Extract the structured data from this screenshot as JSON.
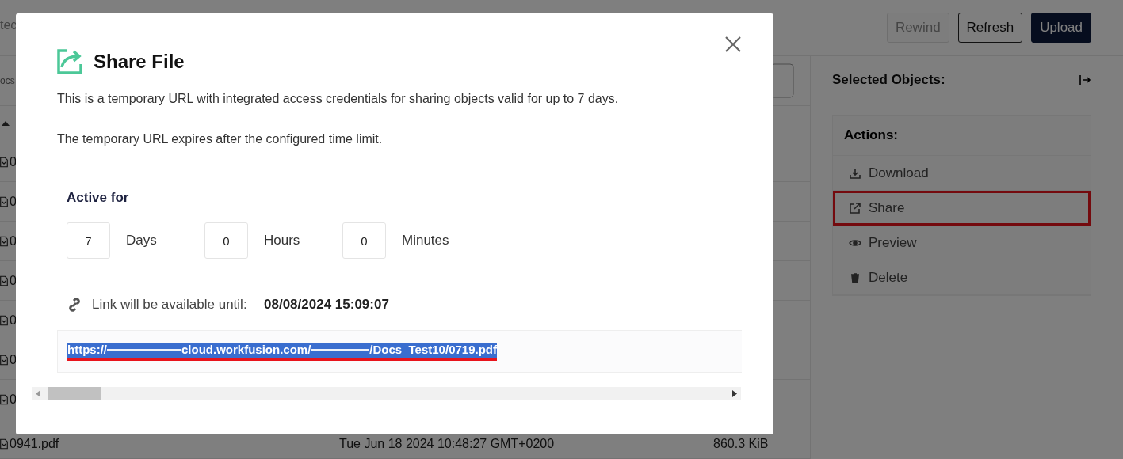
{
  "background": {
    "search_text": "tec",
    "crumb_text": "ocs",
    "toolbar": [
      {
        "label": "Rewind",
        "kind": "ghost",
        "disabled": true
      },
      {
        "label": "Refresh",
        "kind": "outline",
        "disabled": false
      },
      {
        "label": "Upload",
        "kind": "primary",
        "disabled": false
      }
    ],
    "files": [
      {
        "name": "0"
      },
      {
        "name": "0"
      },
      {
        "name": "0"
      },
      {
        "name": "0"
      },
      {
        "name": "0"
      },
      {
        "name": "0"
      },
      {
        "name": "0"
      },
      {
        "name": "0941.pdf",
        "date": "Tue Jun 18 2024 10:48:27 GMT+0200",
        "size": "860.3 KiB"
      }
    ],
    "panel": {
      "title": "Selected Objects:",
      "actions_title": "Actions:",
      "actions": [
        {
          "label": "Download",
          "kind": "download",
          "highlighted": false
        },
        {
          "label": "Share",
          "kind": "share",
          "highlighted": true
        },
        {
          "label": "Preview",
          "kind": "preview",
          "highlighted": false
        },
        {
          "label": "Delete",
          "kind": "delete",
          "highlighted": false
        }
      ]
    }
  },
  "dialog": {
    "title": "Share File",
    "paragraphs": [
      "This is a temporary URL with integrated access credentials for sharing objects valid for up to 7 days.",
      "The temporary URL expires after the configured time limit."
    ],
    "active_for": "Active for",
    "durations": [
      {
        "value": "7",
        "unit": "Days"
      },
      {
        "value": "0",
        "unit": "Hours"
      },
      {
        "value": "0",
        "unit": "Minutes"
      }
    ],
    "available_label": "Link will be available until:",
    "available_until": "08/08/2024 15:09:07",
    "url": {
      "selected": true,
      "underlined": true,
      "parts": [
        {
          "kind": "text",
          "text": "https://"
        },
        {
          "kind": "redacted"
        },
        {
          "kind": "text",
          "text": "cloud.workfusion.com/"
        },
        {
          "kind": "redacted"
        },
        {
          "kind": "text",
          "text": "/Docs_Test10/0719.pdf"
        }
      ]
    }
  }
}
